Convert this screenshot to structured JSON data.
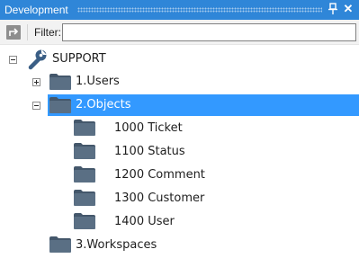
{
  "window": {
    "title": "Development"
  },
  "toolbar": {
    "filter_label": "Filter:",
    "filter_value": ""
  },
  "tree": {
    "root": {
      "label": "SUPPORT",
      "icon": "wrench-icon",
      "expanded": true
    },
    "users": {
      "label": "1.Users",
      "icon": "folder-icon",
      "expanded": false
    },
    "objects": {
      "label": "2.Objects",
      "icon": "folder-icon",
      "expanded": true,
      "selected": true,
      "children": [
        {
          "label": "1000 Ticket",
          "icon": "folder-icon"
        },
        {
          "label": "1100 Status",
          "icon": "folder-icon"
        },
        {
          "label": "1200 Comment",
          "icon": "folder-icon"
        },
        {
          "label": "1300 Customer",
          "icon": "folder-icon"
        },
        {
          "label": "1400 User",
          "icon": "folder-icon"
        }
      ]
    },
    "workspaces": {
      "label": "3.Workspaces",
      "icon": "folder-icon"
    }
  },
  "colors": {
    "titlebar": "#2f86d8",
    "selection": "#3399ff",
    "folder": "#5a6f84",
    "folder_tab": "#44576b"
  }
}
